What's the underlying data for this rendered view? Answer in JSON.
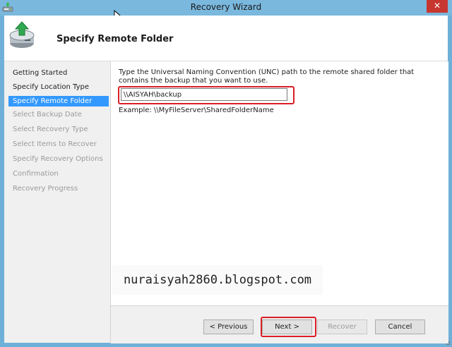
{
  "window": {
    "title": "Recovery Wizard",
    "close_label": "✕"
  },
  "header": {
    "page_title": "Specify Remote Folder",
    "icon": "backup-restore-icon"
  },
  "steps": [
    {
      "label": "Getting Started",
      "state": "done"
    },
    {
      "label": "Specify Location Type",
      "state": "done"
    },
    {
      "label": "Specify Remote Folder",
      "state": "active"
    },
    {
      "label": "Select Backup Date",
      "state": "pending"
    },
    {
      "label": "Select Recovery Type",
      "state": "pending"
    },
    {
      "label": "Select Items to Recover",
      "state": "pending"
    },
    {
      "label": "Specify Recovery Options",
      "state": "pending"
    },
    {
      "label": "Confirmation",
      "state": "pending"
    },
    {
      "label": "Recovery Progress",
      "state": "pending"
    }
  ],
  "content": {
    "instruction": "Type the Universal Naming Convention (UNC) path to the remote shared folder that contains the backup that you want to use.",
    "path_value": "\\\\AISYAH\\backup",
    "example": "Example: \\\\MyFileServer\\SharedFolderName"
  },
  "watermark": "nuraisyah2860.blogspot.com",
  "buttons": {
    "previous": "< Previous",
    "next": "Next >",
    "recover": "Recover",
    "cancel": "Cancel"
  },
  "colors": {
    "accent": "#3399ff",
    "highlight": "#d91f26",
    "titlebar": "#7ab8de",
    "close": "#c7372f"
  }
}
